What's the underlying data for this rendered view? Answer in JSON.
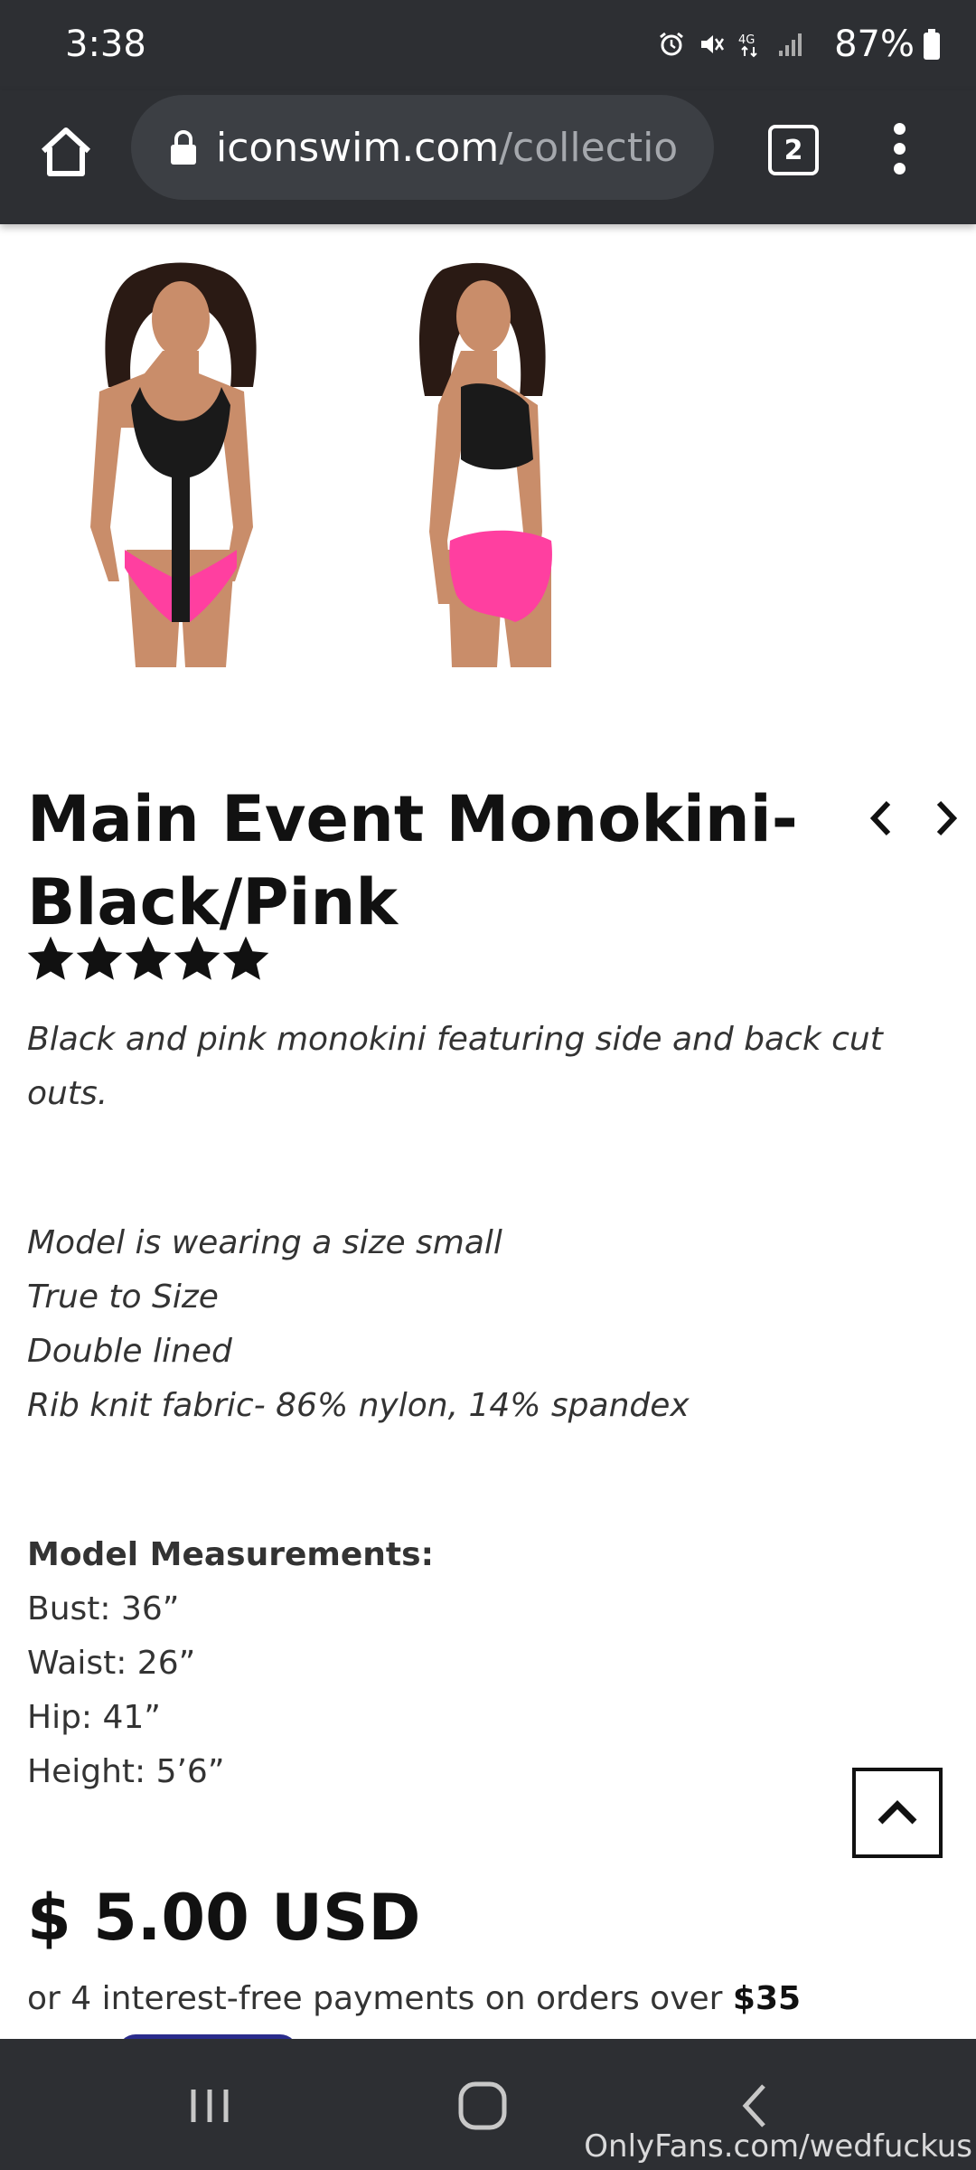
{
  "status_bar": {
    "time": "3:38",
    "battery": "87%",
    "icons": [
      "alarm-icon",
      "mute-icon",
      "4g-icon",
      "signal-icon"
    ]
  },
  "browser": {
    "url_domain": "iconswim.com",
    "url_path": "/collectio",
    "tab_count": "2"
  },
  "product": {
    "title": "Main Event Monokini- Black/Pink",
    "rating": 5,
    "rating_max": 5,
    "description": "Black and pink monokini featuring side and back cut outs.",
    "details": [
      "Model is wearing a size small",
      "True to Size",
      "Double lined",
      "Rib knit fabric- 86% nylon, 14% spandex"
    ],
    "measurements_heading": "Model Measurements:",
    "measurements": [
      "Bust: 36”",
      "Waist: 26”",
      "Hip: 41”",
      "Height: 5’6”"
    ],
    "price": "$ 5.00 USD",
    "installments_text": "or 4 interest-free payments on orders over ",
    "installments_threshold": "$35"
  },
  "colors": {
    "chrome": "#2d2f33",
    "url_bar": "#3c3f44",
    "swim_black": "#1a1a1a",
    "swim_pink": "#ff3fa0"
  },
  "watermark": "OnlyFans.com/wedfuckus"
}
